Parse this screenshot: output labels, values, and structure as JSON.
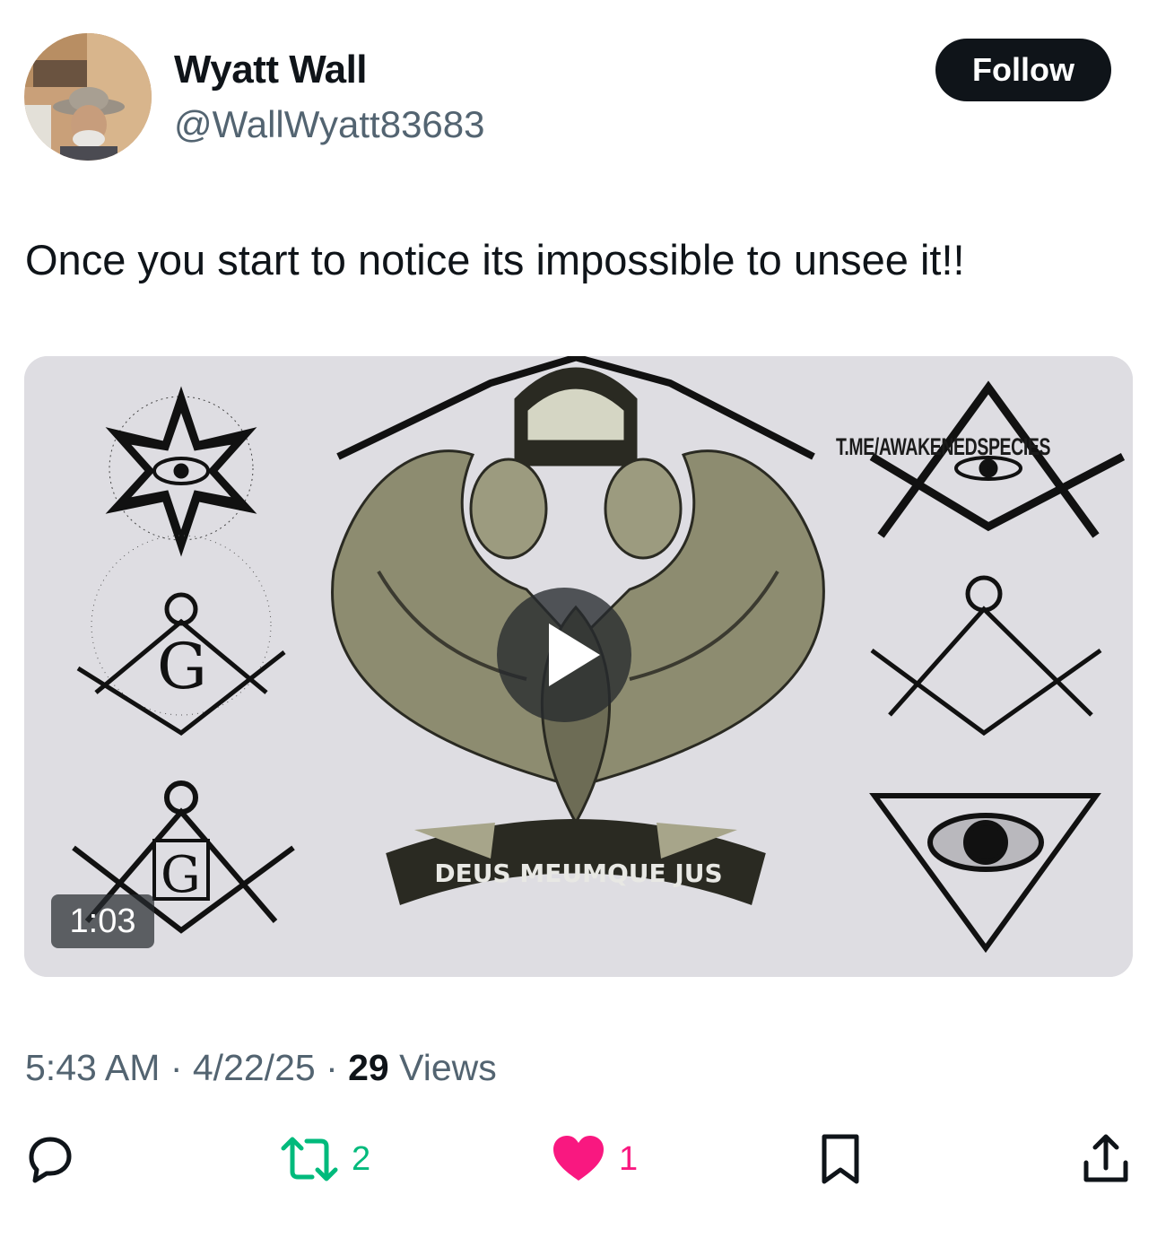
{
  "author": {
    "display_name": "Wyatt Wall",
    "handle": "@WallWyatt83683"
  },
  "follow_label": "Follow",
  "tweet": {
    "text": "Once you start to notice its impossible to unsee it!!"
  },
  "media": {
    "watermark": "T.ME/AWAKENEDSPECIES",
    "banner_text": "DEUS MEUMQUE JUS",
    "duration": "1:03",
    "icon": "play-icon"
  },
  "meta": {
    "time": "5:43 AM",
    "sep1": " · ",
    "date": "4/22/25",
    "sep2": " · ",
    "views_count": "29",
    "views_label": " Views"
  },
  "actions": {
    "reply": {
      "icon": "reply-icon"
    },
    "retweet": {
      "icon": "retweet-icon",
      "count": "2",
      "color": "#00ba7c"
    },
    "like": {
      "icon": "heart-icon",
      "count": "1",
      "color": "#f91880"
    },
    "bookmark": {
      "icon": "bookmark-icon"
    },
    "share": {
      "icon": "share-icon"
    }
  }
}
